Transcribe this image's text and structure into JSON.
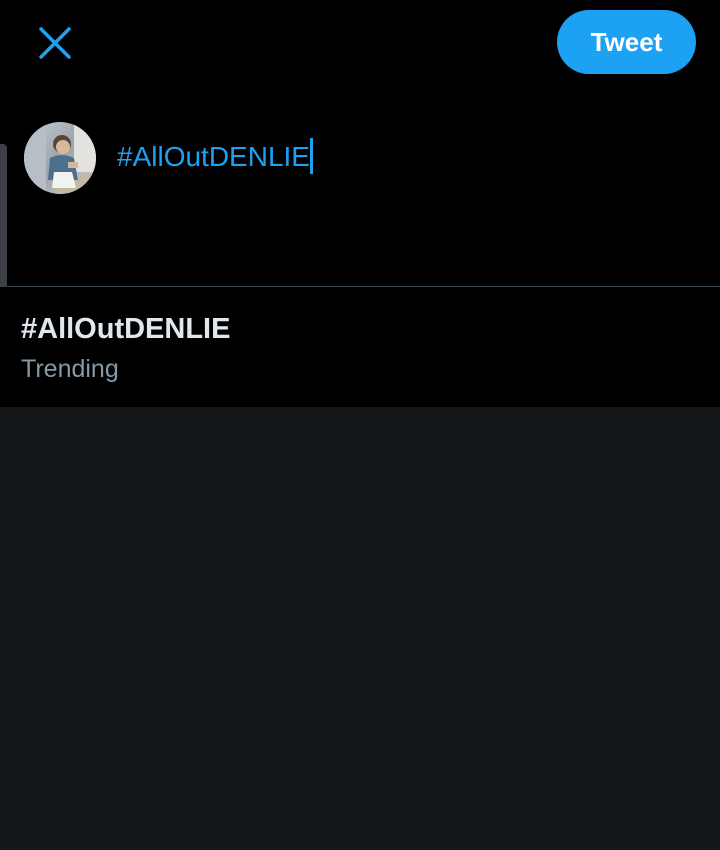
{
  "header": {
    "close_icon": "close-icon",
    "tweet_label": "Tweet"
  },
  "compose": {
    "text": "#AllOutDENLIE",
    "avatar_icon": "user-avatar"
  },
  "suggestions": [
    {
      "title": "#AllOutDENLIE",
      "subtitle": "Trending"
    }
  ],
  "colors": {
    "accent": "#1da1f2",
    "compose_bg": "#000000",
    "page_bg": "#141719",
    "divider": "#38444d",
    "secondary_text": "#8899a6",
    "primary_text": "#e1e8ed"
  }
}
